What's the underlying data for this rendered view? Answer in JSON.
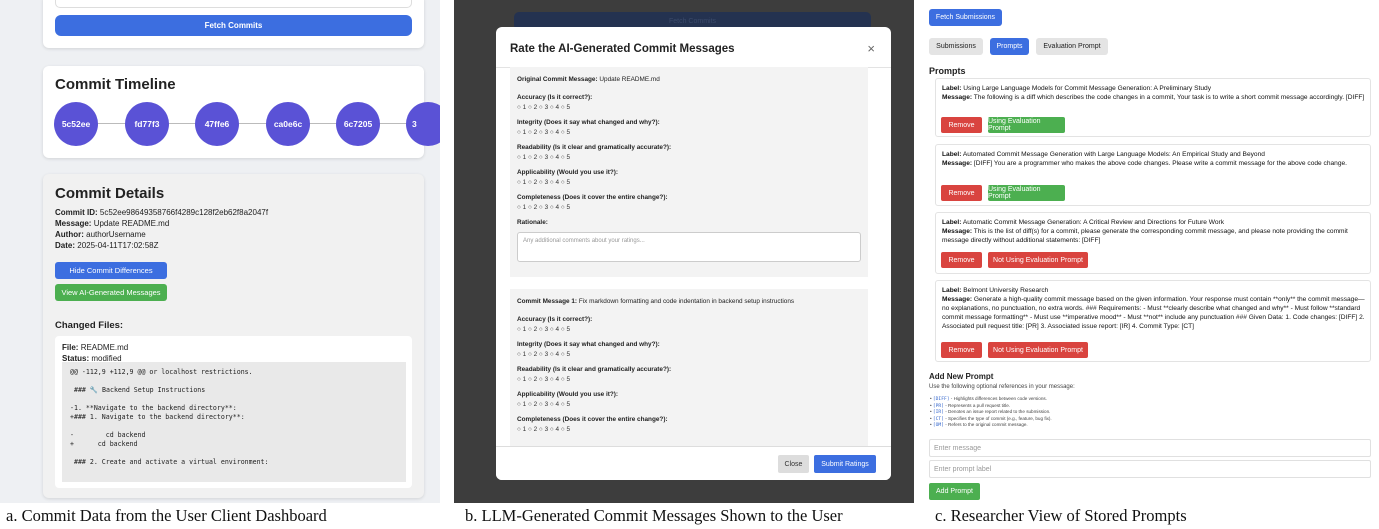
{
  "captions": {
    "a": "a. Commit Data from the User Client Dashboard",
    "b": "b. LLM-Generated Commit Messages Shown to the User",
    "c": "c. Researcher View of Stored Prompts"
  },
  "panel_a": {
    "fetch_button": "Fetch Commits",
    "timeline_title": "Commit Timeline",
    "commits": [
      "5c52ee",
      "fd77f3",
      "47ffe6",
      "ca0e6c",
      "6c7205",
      "3"
    ],
    "details_title": "Commit Details",
    "commit_id_label": "Commit ID:",
    "commit_id": "5c52ee98649358766f4289c128f2eb62f8a2047f",
    "message_label": "Message:",
    "message": "Update README.md",
    "author_label": "Author:",
    "author": "authorUsername",
    "date_label": "Date:",
    "date": "2025-04-11T17:02:58Z",
    "hide_diff_button": "Hide Commit Differences",
    "view_ai_button": "View AI-Generated Messages",
    "changed_files_title": "Changed Files:",
    "file_label": "File:",
    "file": "README.md",
    "status_label": "Status:",
    "status": "modified",
    "diff": "@@ -112,9 +112,9 @@ or localhost restrictions.\n\n ### 🔧 Backend Setup Instructions\n\n-1. **Navigate to the backend directory**:\n+### 1. Navigate to the backend directory**:\n\n-        cd backend\n+      cd backend\n\n ### 2. Create and activate a virtual environment:"
  },
  "panel_b": {
    "bg_button": "Fetch Commits",
    "title": "Rate the AI-Generated Commit Messages",
    "close": "×",
    "original_label": "Original Commit Message:",
    "original_message": "Update README.md",
    "questions": [
      "Accuracy (Is it correct?):",
      "Integrity (Does it say what changed and why?):",
      "Readability (Is it clear and gramatically accurate?):",
      "Applicability (Would you use it?):",
      "Completeness (Does it cover the entire change?):"
    ],
    "radio_options": "○ 1  ○ 2  ○ 3  ○ 4  ○ 5",
    "rationale_label": "Rationale:",
    "rationale_placeholder": "Any additional comments about your ratings...",
    "msg1_label": "Commit Message 1:",
    "msg1": "Fix markdown formatting and code indentation in backend setup instructions",
    "close_button": "Close",
    "submit_button": "Submit Ratings"
  },
  "panel_c": {
    "fetch_button": "Fetch Submissions",
    "tabs": [
      "Submissions",
      "Prompts",
      "Evaluation Prompt"
    ],
    "prompts_title": "Prompts",
    "label_key": "Label:",
    "message_key": "Message:",
    "remove": "Remove",
    "prompts": [
      {
        "label": "Using Large Language Models for Commit Message Generation: A Preliminary Study",
        "message": "The following is a diff which describes the code changes in a commit, Your task is to write a short commit message accordingly. [DIFF]",
        "eval": "Using Evaluation Prompt"
      },
      {
        "label": "Automated Commit Message Generation with Large Language Models: An Empirical Study and Beyond",
        "message": "[DIFF] You are a programmer who makes the above code changes. Please write a commit message for the above code change.",
        "eval": "Using Evaluation Prompt"
      },
      {
        "label": "Automatic Commit Message Generation: A Critical Review and Directions for Future Work",
        "message": "This is the list of diff(s) for a commit, please generate the corresponding commit message, and please note providing the commit message directly without additional statements: [DIFF]",
        "eval": "Not Using Evaluation Prompt"
      },
      {
        "label": "Belmont University Research",
        "message": "Generate a high-quality commit message based on the given information. Your response must contain **only** the commit message—no explanations, no punctuation, no extra words. ### Requirements: - Must **clearly describe what changed and why** - Must follow **standard commit message formatting** - Must use **imperative mood** - Must **not** include any punctuation ### Given Data: 1. Code changes: [DIFF] 2. Associated pull request title: [PR] 3. Associated issue report: [IR] 4. Commit Type: [CT]",
        "eval": "Not Using Evaluation Prompt"
      }
    ],
    "add_title": "Add New Prompt",
    "add_hint": "Use the following optional references in your message:",
    "refs": [
      {
        "k": "[DIFF]",
        "d": " - Highlights differences between code versions."
      },
      {
        "k": "[PR]",
        "d": " - Represents a pull request title."
      },
      {
        "k": "[IR]",
        "d": " - Denotes an issue report related to the submission."
      },
      {
        "k": "[CT]",
        "d": " - Specifies the type of commit (e.g., feature, bug fix)."
      },
      {
        "k": "[OM]",
        "d": " - Refers to the original commit message."
      }
    ],
    "message_placeholder": "Enter message",
    "label_placeholder": "Enter prompt label",
    "add_button": "Add Prompt"
  },
  "colors": {
    "blue": "#3c6ee0",
    "green": "#4caf50",
    "red": "#d9443f",
    "purple": "#5a52d6"
  }
}
